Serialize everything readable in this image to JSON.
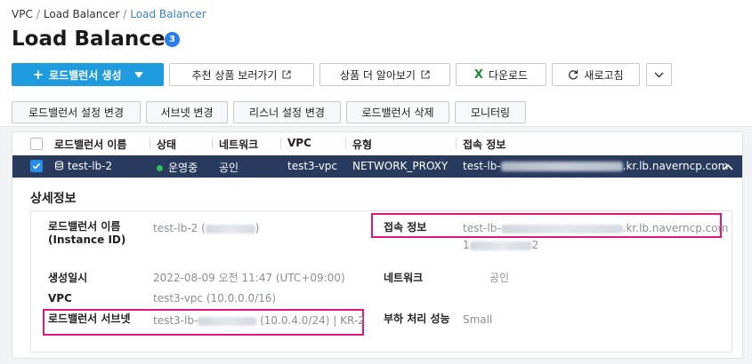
{
  "breadcrumb": {
    "item1": "VPC",
    "item2": "Load Balancer",
    "item3": "Load Balancer"
  },
  "title": "Load Balancer",
  "title_count": "3",
  "toolbar": {
    "create": "로드밸런서 생성",
    "recommend": "추천 상품 보러가기",
    "learn_more": "상품 더 알아보기",
    "download": "다운로드",
    "refresh": "새로고침"
  },
  "actions": {
    "change_settings": "로드밸런서 설정 변경",
    "change_subnet": "서브넷 변경",
    "change_listener": "리스너 설정 변경",
    "delete": "로드밸런서 삭제",
    "monitoring": "모니터링"
  },
  "table": {
    "headers": [
      "로드밸런서 이름",
      "상태",
      "네트워크",
      "VPC",
      "유형",
      "접속 정보"
    ],
    "row": {
      "name": "test-lb-2",
      "status": "운영중",
      "network": "공인",
      "vpc": "test3-vpc",
      "type": "NETWORK_PROXY",
      "access_prefix": "test-lb-",
      "access_suffix": ".kr.lb.naverncp.com"
    }
  },
  "detail": {
    "section_title": "상세정보",
    "name_label": "로드밸런서 이름",
    "instance_label": "(Instance ID)",
    "name_value_prefix": "test-lb-2 (",
    "name_value_suffix": ")",
    "access_label": "접속 정보",
    "access_prefix": "test-lb-",
    "access_suffix": ".kr.lb.naverncp.com",
    "access_ip_prefix": "1",
    "access_ip_suffix": "2",
    "created_label": "생성일시",
    "created_value": "2022-08-09 오전 11:47 (UTC+09:00)",
    "network_label": "네트워크",
    "network_value": "공인",
    "vpc_label": "VPC",
    "vpc_value": "test3-vpc (10.0.0.0/16)",
    "subnet_label": "로드밸런서 서브넷",
    "subnet_prefix": "test3-lb-",
    "subnet_suffix": " (10.0.4.0/24) | KR-2",
    "perf_label": "부하 처리 성능",
    "perf_value": "Small"
  },
  "colors": {
    "primary": "#1e9bdf",
    "selected_row": "#283a5e",
    "highlight": "#e0177a",
    "status_running": "#2fc25b"
  }
}
